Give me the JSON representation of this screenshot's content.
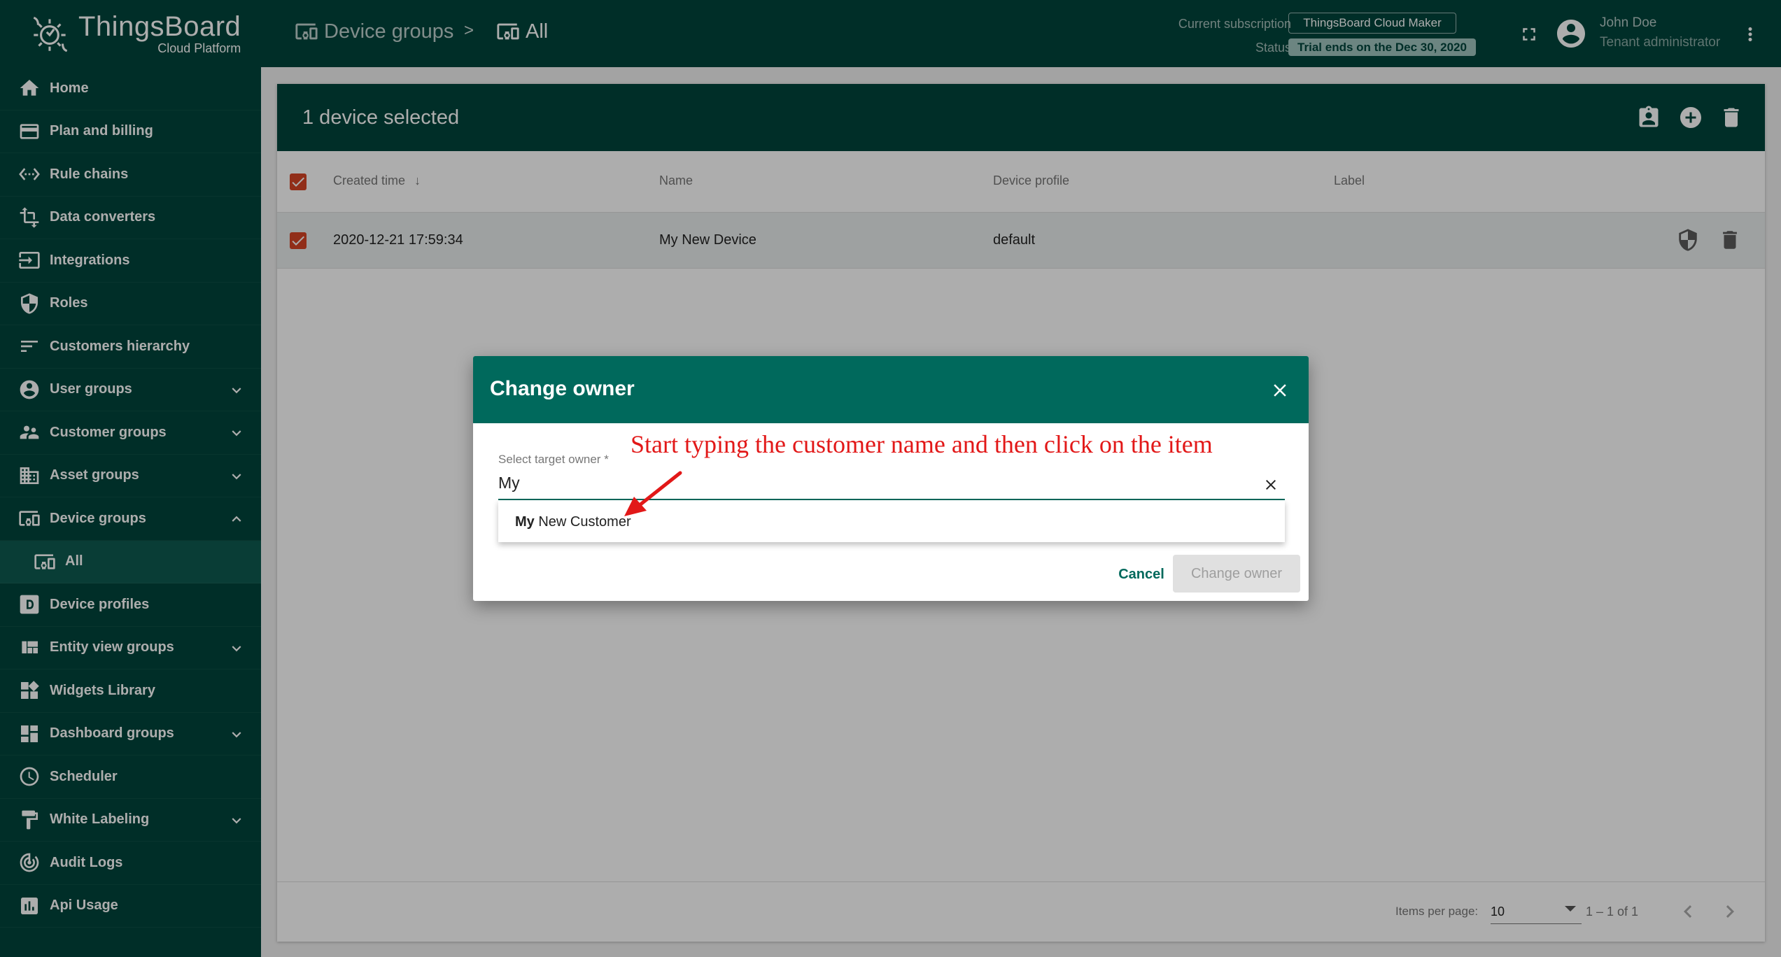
{
  "app": {
    "brand": "ThingsBoard",
    "sub_brand": "Cloud Platform"
  },
  "sidebar": {
    "items": [
      {
        "label": "Home",
        "icon": "home-icon"
      },
      {
        "label": "Plan and billing",
        "icon": "credit-card-icon"
      },
      {
        "label": "Rule chains",
        "icon": "settings-ethernet-icon"
      },
      {
        "label": "Data converters",
        "icon": "transform-icon"
      },
      {
        "label": "Integrations",
        "icon": "input-icon"
      },
      {
        "label": "Roles",
        "icon": "security-icon"
      },
      {
        "label": "Customers hierarchy",
        "icon": "sort-icon"
      },
      {
        "label": "User groups",
        "icon": "account-circle-icon",
        "expandable": true
      },
      {
        "label": "Customer groups",
        "icon": "supervisor-account-icon",
        "expandable": true
      },
      {
        "label": "Asset groups",
        "icon": "domain-icon",
        "expandable": true
      },
      {
        "label": "Device groups",
        "icon": "devices-other-icon",
        "expandable": true,
        "expanded": true
      },
      {
        "label": "All",
        "icon": "devices-other-icon",
        "sub": true
      },
      {
        "label": "Device profiles",
        "icon": "device-profile-icon"
      },
      {
        "label": "Entity view groups",
        "icon": "view-quilt-icon",
        "expandable": true
      },
      {
        "label": "Widgets Library",
        "icon": "widgets-icon"
      },
      {
        "label": "Dashboard groups",
        "icon": "dashboard-icon",
        "expandable": true
      },
      {
        "label": "Scheduler",
        "icon": "schedule-icon"
      },
      {
        "label": "White Labeling",
        "icon": "format-paint-icon",
        "expandable": true
      },
      {
        "label": "Audit Logs",
        "icon": "track-changes-icon"
      },
      {
        "label": "Api Usage",
        "icon": "insert-chart-icon"
      }
    ]
  },
  "topbar": {
    "breadcrumb": [
      "Device groups",
      "All"
    ],
    "breadcrumb_sep": ">",
    "subscription_label": "Current subscription",
    "subscription_value": "ThingsBoard Cloud Maker",
    "status_label": "Status",
    "status_value": "Trial ends on the Dec 30, 2020",
    "user_name": "John Doe",
    "user_role": "Tenant administrator"
  },
  "table": {
    "selection_title": "1 device selected",
    "columns": [
      "Created time",
      "Name",
      "Device profile",
      "Label"
    ],
    "rows": [
      {
        "created": "2020-12-21 17:59:34",
        "name": "My New Device",
        "profile": "default",
        "label": ""
      }
    ],
    "items_per_page_label": "Items per page:",
    "items_per_page": "10",
    "range": "1 – 1 of 1"
  },
  "dialog": {
    "title": "Change owner",
    "field_label": "Select target owner *",
    "field_value": "My",
    "option_match": "My",
    "option_rest": " New Customer",
    "cancel_label": "Cancel",
    "submit_label": "Change owner"
  },
  "annotation": {
    "text": "Start typing the customer name and then click on the item",
    "color": "#e21818"
  },
  "colors": {
    "primary_dark": "#00453b",
    "primary": "#00695c",
    "checkbox": "#d64525"
  }
}
